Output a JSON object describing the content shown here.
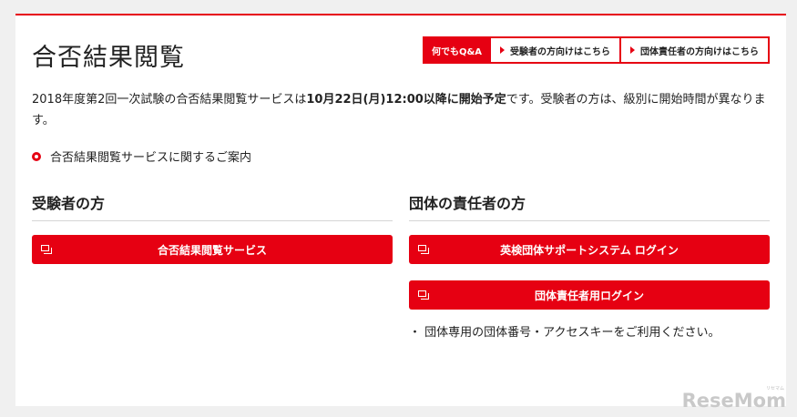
{
  "header": {
    "title": "合否結果閲覧",
    "tabs": [
      {
        "label": "何でもQ&A"
      },
      {
        "label": "受験者の方向けはこちら"
      },
      {
        "label": "団体責任者の方向けはこちら"
      }
    ]
  },
  "notice": {
    "part1": "2018年度第2回一次試験の合否結果閲覧サービスは",
    "bold": "10月22日(月)12:00以降に開始予定",
    "part2": "です。受験者の方は、級別に開始時間が異なります。"
  },
  "guide_link": "合否結果閲覧サービスに関するご案内",
  "sections": {
    "examinee": {
      "heading": "受験者の方",
      "button": "合否結果閲覧サービス"
    },
    "group": {
      "heading": "団体の責任者の方",
      "button1": "英検団体サポートシステム ログイン",
      "button2": "団体責任者用ログイン",
      "note": "・ 団体専用の団体番号・アクセスキーをご利用ください。"
    }
  },
  "watermark": {
    "text": "ReseMom",
    "small": "リセマム"
  },
  "colors": {
    "accent": "#e60012",
    "background": "#f0f0f0"
  }
}
